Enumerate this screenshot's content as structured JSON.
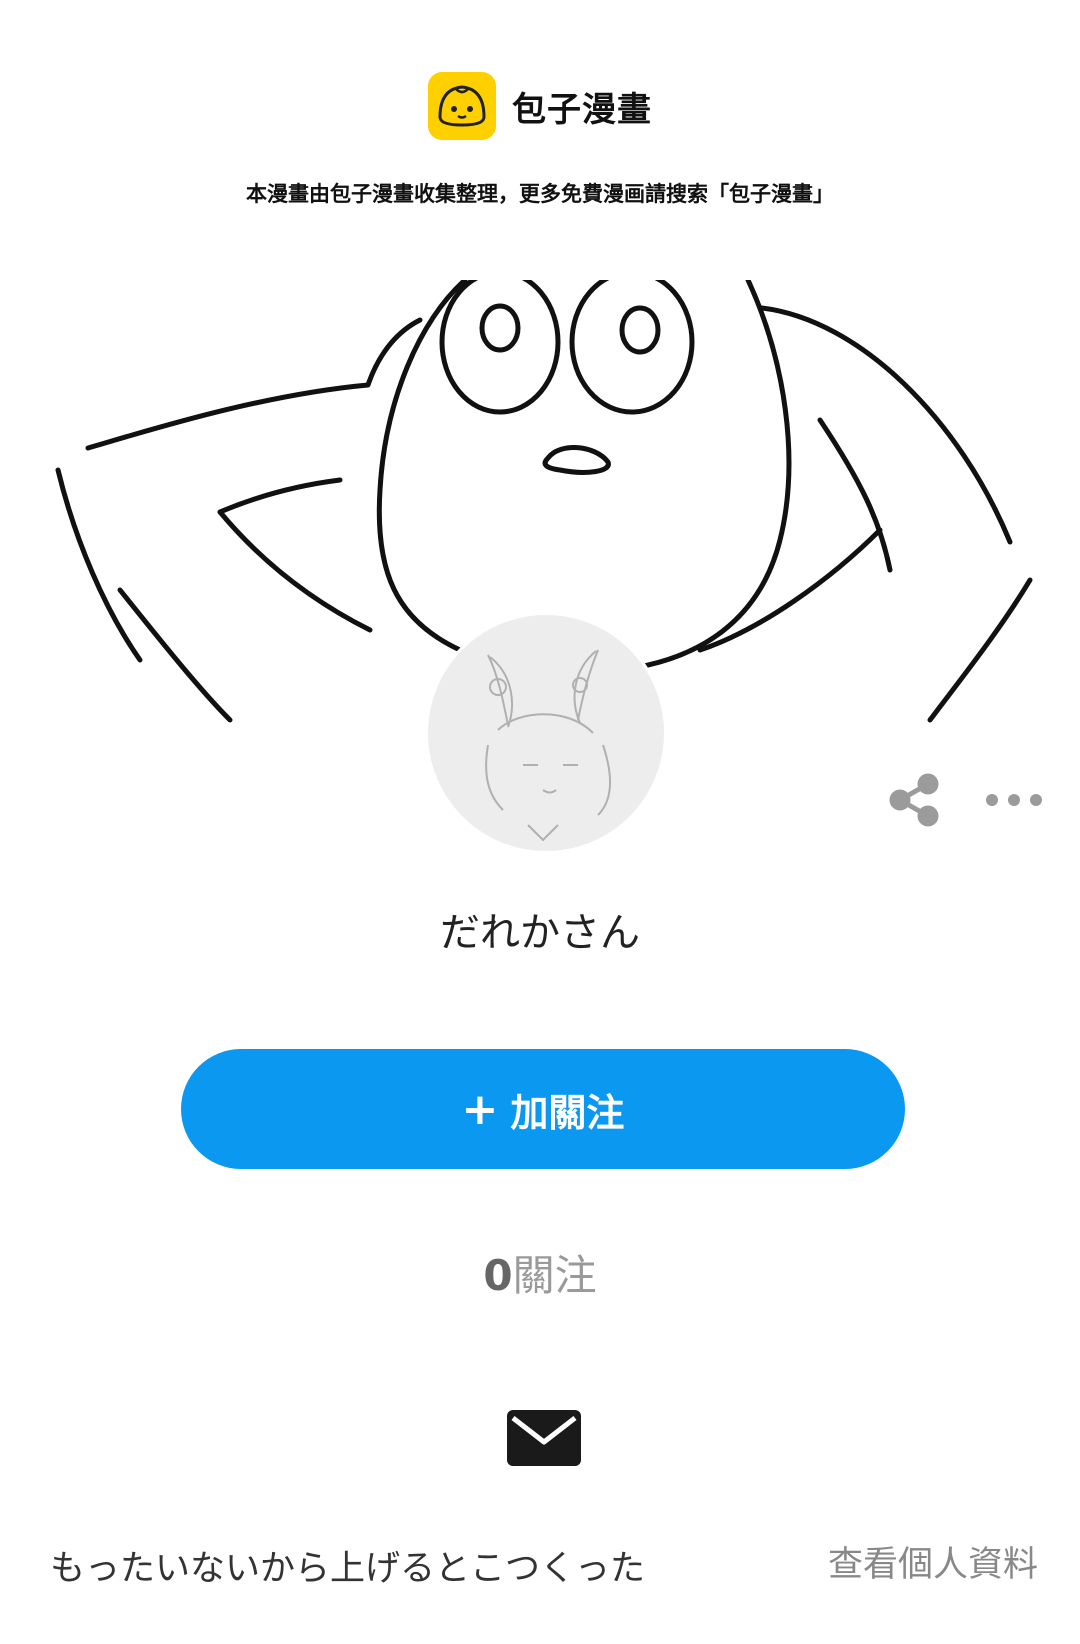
{
  "brand": {
    "name": "包子漫畫",
    "logo_icon": "bun-logo-icon",
    "logo_color": "#ffd000"
  },
  "notice": "本漫畫由包子漫畫收集整理，更多免費漫画請搜索「包子漫畫」",
  "profile": {
    "name": "だれかさん",
    "follow_button": {
      "icon": "+",
      "label": "加關注",
      "color": "#0a98f0"
    },
    "follow_count": {
      "value": "0",
      "label": "關注"
    },
    "bio": "もったいないから上げるとこつくった",
    "view_profile_link": "查看個人資料"
  },
  "actions": {
    "share_icon": "share-icon",
    "more_icon": "more-icon",
    "message_icon": "mail-icon"
  }
}
